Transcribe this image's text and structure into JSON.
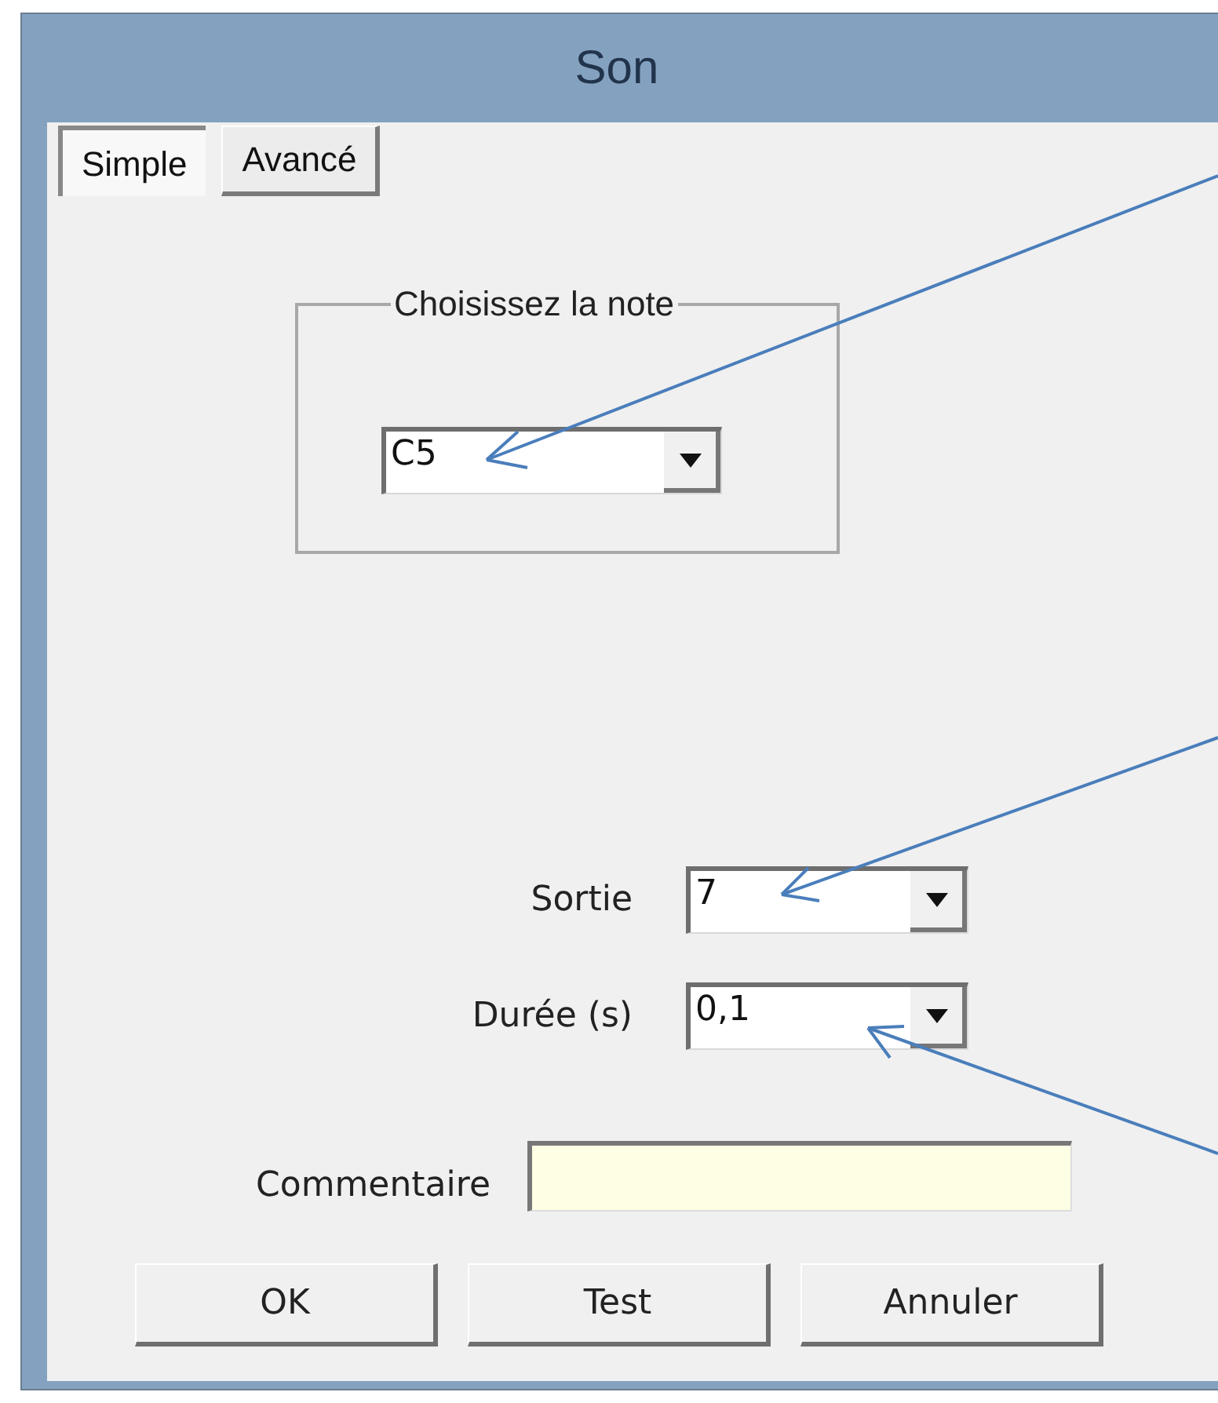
{
  "window": {
    "title": "Son"
  },
  "tabs": [
    {
      "label": "Simple",
      "selected": true
    },
    {
      "label": "Avancé",
      "selected": false
    }
  ],
  "note_group": {
    "legend": "Choisissez la note",
    "value": "C5"
  },
  "fields": [
    {
      "label": "Sortie",
      "value": "7"
    },
    {
      "label": "Durée (s)",
      "value": "0,1"
    }
  ],
  "comment": {
    "label": "Commentaire"
  },
  "buttons": [
    "OK",
    "Test",
    "Annuler"
  ]
}
